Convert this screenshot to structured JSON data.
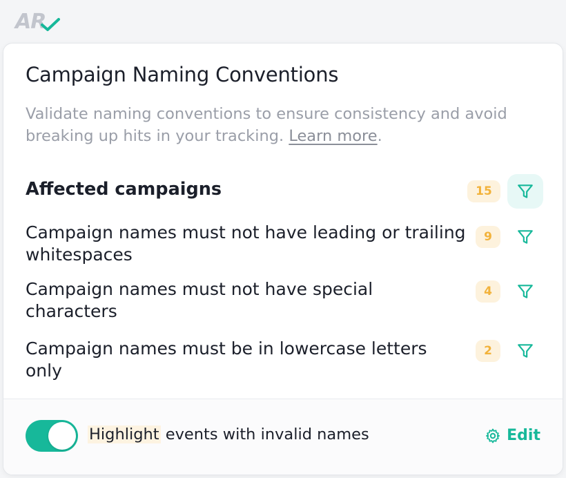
{
  "logo": {
    "text": "AR"
  },
  "panel": {
    "title": "Campaign Naming Conventions",
    "description": "Validate naming conventions to ensure consistency and avoid breaking up hits in your tracking.",
    "learn_more": "Learn more",
    "section_title": "Affected campaigns",
    "total_count": "15",
    "rules": [
      {
        "label": "Campaign names must not have leading or trailing whitespaces",
        "count": "9"
      },
      {
        "label": "Campaign names must not have special characters",
        "count": "4"
      },
      {
        "label": "Campaign names must be in lowercase letters only",
        "count": "2"
      }
    ]
  },
  "footer": {
    "toggle_on": true,
    "highlight_word": "Highlight",
    "highlight_rest": " events with invalid names",
    "edit_label": "Edit"
  },
  "colors": {
    "accent": "#17b89a",
    "badge_bg": "#fdf2dd",
    "badge_text": "#f2b23a"
  },
  "icons": {
    "filter": "filter-icon",
    "gear": "gear-icon",
    "logo_check": "check-icon"
  }
}
